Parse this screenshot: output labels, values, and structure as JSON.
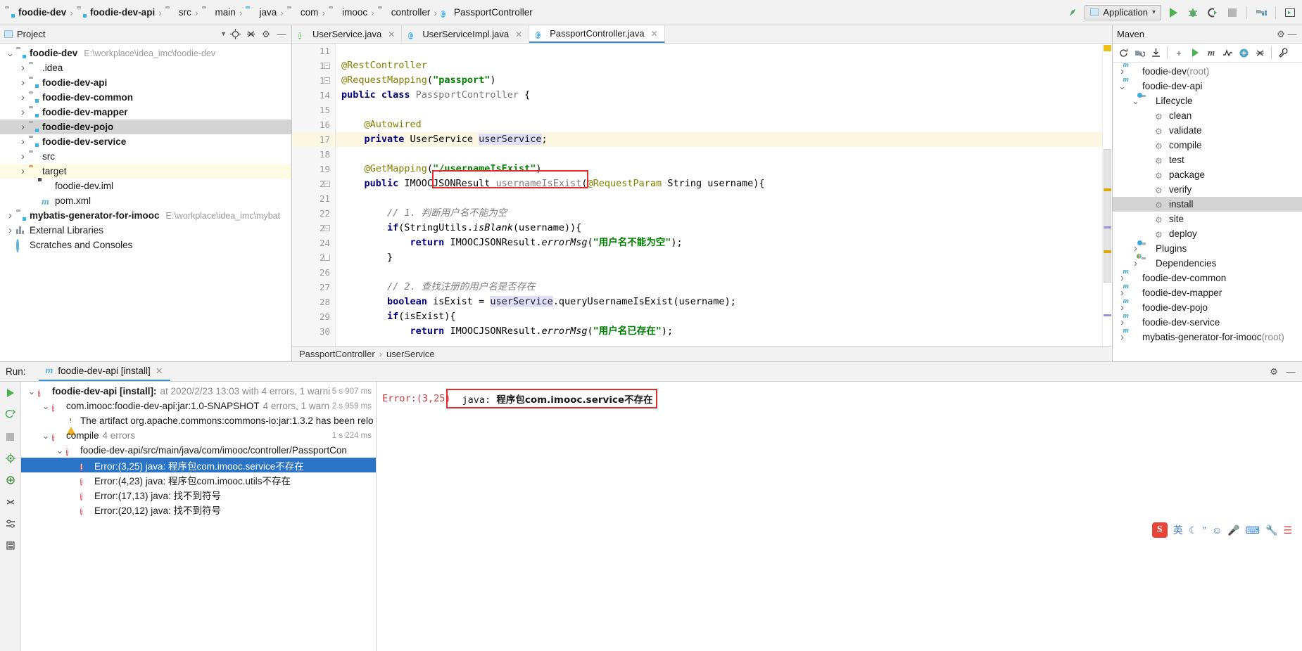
{
  "topbar": {
    "breadcrumbs": [
      {
        "label": "foodie-dev",
        "icon": "module-folder-icon",
        "bold": true
      },
      {
        "label": "foodie-dev-api",
        "icon": "module-folder-icon",
        "bold": true
      },
      {
        "label": "src",
        "icon": "folder-icon",
        "bold": false
      },
      {
        "label": "main",
        "icon": "folder-icon",
        "bold": false
      },
      {
        "label": "java",
        "icon": "source-folder-icon",
        "bold": false
      },
      {
        "label": "com",
        "icon": "package-folder-icon",
        "bold": false
      },
      {
        "label": "imooc",
        "icon": "package-folder-icon",
        "bold": false
      },
      {
        "label": "controller",
        "icon": "package-folder-icon",
        "bold": false
      },
      {
        "label": "PassportController",
        "icon": "class-icon",
        "bold": false
      }
    ],
    "run_config": "Application",
    "buttons": {
      "run": "run-button",
      "debug": "debug-button",
      "run_coverage": "run-with-coverage-button",
      "stop": "stop-button",
      "project_structure": "project-structure-button",
      "layout": "layout-button"
    }
  },
  "project": {
    "title": "Project",
    "tree": [
      {
        "label": "foodie-dev",
        "path": "E:\\workplace\\idea_imc\\foodie-dev",
        "indent": 0,
        "arrow": "down",
        "icon": "module-folder-icon",
        "bold": true,
        "state": "normal"
      },
      {
        "label": ".idea",
        "path": "",
        "indent": 1,
        "arrow": "right",
        "icon": "folder-icon",
        "bold": false,
        "state": "normal"
      },
      {
        "label": "foodie-dev-api",
        "path": "",
        "indent": 1,
        "arrow": "right",
        "icon": "module-folder-icon",
        "bold": true,
        "state": "normal"
      },
      {
        "label": "foodie-dev-common",
        "path": "",
        "indent": 1,
        "arrow": "right",
        "icon": "module-folder-icon",
        "bold": true,
        "state": "normal"
      },
      {
        "label": "foodie-dev-mapper",
        "path": "",
        "indent": 1,
        "arrow": "right",
        "icon": "module-folder-icon",
        "bold": true,
        "state": "normal"
      },
      {
        "label": "foodie-dev-pojo",
        "path": "",
        "indent": 1,
        "arrow": "right",
        "icon": "module-folder-icon",
        "bold": true,
        "state": "selected"
      },
      {
        "label": "foodie-dev-service",
        "path": "",
        "indent": 1,
        "arrow": "right",
        "icon": "module-folder-icon",
        "bold": true,
        "state": "normal"
      },
      {
        "label": "src",
        "path": "",
        "indent": 1,
        "arrow": "right",
        "icon": "folder-icon",
        "bold": false,
        "state": "normal"
      },
      {
        "label": "target",
        "path": "",
        "indent": 1,
        "arrow": "right",
        "icon": "target-folder-icon",
        "bold": false,
        "state": "highlight"
      },
      {
        "label": "foodie-dev.iml",
        "path": "",
        "indent": 2,
        "arrow": "",
        "icon": "iml-file-icon",
        "bold": false,
        "state": "normal"
      },
      {
        "label": "pom.xml",
        "path": "",
        "indent": 2,
        "arrow": "",
        "icon": "maven-file-icon",
        "bold": false,
        "state": "normal"
      },
      {
        "label": "mybatis-generator-for-imooc",
        "path": "E:\\workplace\\idea_imc\\mybat",
        "indent": 0,
        "arrow": "right",
        "icon": "module-folder-icon",
        "bold": true,
        "state": "normal"
      },
      {
        "label": "External Libraries",
        "path": "",
        "indent": 0,
        "arrow": "right",
        "icon": "library-icon",
        "bold": false,
        "state": "normal"
      },
      {
        "label": "Scratches and Consoles",
        "path": "",
        "indent": 0,
        "arrow": "",
        "icon": "scratches-icon",
        "bold": false,
        "state": "normal"
      }
    ]
  },
  "editor": {
    "tabs": [
      {
        "label": "UserService.java",
        "icon": "interface-icon",
        "active": false
      },
      {
        "label": "UserServiceImpl.java",
        "icon": "class-icon",
        "active": false
      },
      {
        "label": "PassportController.java",
        "icon": "class-icon",
        "active": true
      }
    ],
    "first_line": 11,
    "lines": [
      {
        "n": 11,
        "tokens": [],
        "highlight": false
      },
      {
        "n": 12,
        "tokens": [
          {
            "t": "@RestController",
            "c": "ann"
          }
        ],
        "highlight": false,
        "fold": "minus"
      },
      {
        "n": 13,
        "tokens": [
          {
            "t": "@RequestMapping",
            "c": "ann"
          },
          {
            "t": "(",
            "c": "plain"
          },
          {
            "t": "\"passport\"",
            "c": "str"
          },
          {
            "t": ")",
            "c": "plain"
          }
        ],
        "highlight": false,
        "fold": "minus"
      },
      {
        "n": 14,
        "tokens": [
          {
            "t": "public class ",
            "c": "kw"
          },
          {
            "t": "PassportController",
            "c": "cls"
          },
          {
            "t": " {",
            "c": "plain"
          }
        ],
        "highlight": false
      },
      {
        "n": 15,
        "tokens": [],
        "highlight": false
      },
      {
        "n": 16,
        "tokens": [
          {
            "t": "    @Autowired",
            "c": "ann"
          }
        ],
        "highlight": false
      },
      {
        "n": 17,
        "tokens": [
          {
            "t": "    private ",
            "c": "kw"
          },
          {
            "t": "UserService ",
            "c": "plain"
          },
          {
            "t": "userService",
            "c": "fld-hl"
          },
          {
            "t": ";",
            "c": "plain"
          }
        ],
        "highlight": true
      },
      {
        "n": 18,
        "tokens": [],
        "highlight": false
      },
      {
        "n": 19,
        "tokens": [
          {
            "t": "    @GetMapping",
            "c": "ann"
          },
          {
            "t": "(",
            "c": "plain"
          },
          {
            "t": "\"/usernameIsExist\"",
            "c": "str"
          },
          {
            "t": ")",
            "c": "plain"
          }
        ],
        "highlight": false
      },
      {
        "n": 20,
        "tokens": [
          {
            "t": "    public ",
            "c": "kw"
          },
          {
            "t": "IMOOCJSONResult ",
            "c": "plain"
          },
          {
            "t": "usernameIsExist",
            "c": "cls"
          },
          {
            "t": "(",
            "c": "plain"
          },
          {
            "t": "@RequestParam",
            "c": "ann"
          },
          {
            "t": " String username){",
            "c": "plain"
          }
        ],
        "highlight": false,
        "fold": "minus"
      },
      {
        "n": 21,
        "tokens": [],
        "highlight": false
      },
      {
        "n": 22,
        "tokens": [
          {
            "t": "        // 1. 判断用户名不能为空",
            "c": "cmt"
          }
        ],
        "highlight": false
      },
      {
        "n": 23,
        "tokens": [
          {
            "t": "        if",
            "c": "kw"
          },
          {
            "t": "(StringUtils.",
            "c": "plain"
          },
          {
            "t": "isBlank",
            "c": "mth"
          },
          {
            "t": "(username)){",
            "c": "plain"
          }
        ],
        "highlight": false,
        "fold": "minus"
      },
      {
        "n": 24,
        "tokens": [
          {
            "t": "            return ",
            "c": "kw"
          },
          {
            "t": "IMOOCJSONResult.",
            "c": "plain"
          },
          {
            "t": "errorMsg",
            "c": "mth"
          },
          {
            "t": "(",
            "c": "plain"
          },
          {
            "t": "\"用户名不能为空\"",
            "c": "str"
          },
          {
            "t": ");",
            "c": "plain"
          }
        ],
        "highlight": false
      },
      {
        "n": 25,
        "tokens": [
          {
            "t": "        }",
            "c": "plain"
          }
        ],
        "highlight": false,
        "fold": "end"
      },
      {
        "n": 26,
        "tokens": [],
        "highlight": false
      },
      {
        "n": 27,
        "tokens": [
          {
            "t": "        // 2. 查找注册的用户名是否存在",
            "c": "cmt"
          }
        ],
        "highlight": false
      },
      {
        "n": 28,
        "tokens": [
          {
            "t": "        boolean ",
            "c": "kw"
          },
          {
            "t": "isExist = ",
            "c": "plain"
          },
          {
            "t": "userService",
            "c": "fld-hl"
          },
          {
            "t": ".queryUsernameIsExist(username);",
            "c": "plain"
          }
        ],
        "highlight": false
      },
      {
        "n": 29,
        "tokens": [
          {
            "t": "        if",
            "c": "kw"
          },
          {
            "t": "(isExist){",
            "c": "plain"
          }
        ],
        "highlight": false
      },
      {
        "n": 30,
        "tokens": [
          {
            "t": "            return ",
            "c": "kw"
          },
          {
            "t": "IMOOCJSONResult.",
            "c": "plain"
          },
          {
            "t": "errorMsg",
            "c": "mth"
          },
          {
            "t": "(",
            "c": "plain"
          },
          {
            "t": "\"用户名已存在\"",
            "c": "str"
          },
          {
            "t": ");",
            "c": "plain"
          }
        ],
        "highlight": false
      }
    ],
    "breadcrumb": [
      "PassportController",
      "userService"
    ]
  },
  "maven": {
    "title": "Maven",
    "toolbar": [
      "reimport-icon",
      "generate-sources-icon",
      "download-sources-icon",
      "add-icon",
      "run-icon",
      "execute-goal-icon",
      "skip-tests-icon",
      "toggle-offline-icon",
      "collapse-all-icon",
      "settings-icon"
    ],
    "tree": [
      {
        "label": "foodie-dev",
        "suffix": " (root)",
        "indent": 0,
        "arrow": "right",
        "icon": "maven-project-icon",
        "state": "normal"
      },
      {
        "label": "foodie-dev-api",
        "suffix": "",
        "indent": 0,
        "arrow": "down",
        "icon": "maven-project-icon",
        "state": "normal"
      },
      {
        "label": "Lifecycle",
        "suffix": "",
        "indent": 1,
        "arrow": "down",
        "icon": "lifecycle-folder-icon",
        "state": "normal"
      },
      {
        "label": "clean",
        "suffix": "",
        "indent": 2,
        "arrow": "",
        "icon": "goal-icon",
        "state": "normal"
      },
      {
        "label": "validate",
        "suffix": "",
        "indent": 2,
        "arrow": "",
        "icon": "goal-icon",
        "state": "normal"
      },
      {
        "label": "compile",
        "suffix": "",
        "indent": 2,
        "arrow": "",
        "icon": "goal-icon",
        "state": "normal"
      },
      {
        "label": "test",
        "suffix": "",
        "indent": 2,
        "arrow": "",
        "icon": "goal-icon",
        "state": "normal"
      },
      {
        "label": "package",
        "suffix": "",
        "indent": 2,
        "arrow": "",
        "icon": "goal-icon",
        "state": "normal"
      },
      {
        "label": "verify",
        "suffix": "",
        "indent": 2,
        "arrow": "",
        "icon": "goal-icon",
        "state": "normal"
      },
      {
        "label": "install",
        "suffix": "",
        "indent": 2,
        "arrow": "",
        "icon": "goal-icon",
        "state": "selected"
      },
      {
        "label": "site",
        "suffix": "",
        "indent": 2,
        "arrow": "",
        "icon": "goal-icon",
        "state": "normal"
      },
      {
        "label": "deploy",
        "suffix": "",
        "indent": 2,
        "arrow": "",
        "icon": "goal-icon",
        "state": "normal"
      },
      {
        "label": "Plugins",
        "suffix": "",
        "indent": 1,
        "arrow": "right",
        "icon": "plugins-folder-icon",
        "state": "normal"
      },
      {
        "label": "Dependencies",
        "suffix": "",
        "indent": 1,
        "arrow": "right",
        "icon": "dependencies-folder-icon",
        "state": "normal"
      },
      {
        "label": "foodie-dev-common",
        "suffix": "",
        "indent": 0,
        "arrow": "right",
        "icon": "maven-project-icon",
        "state": "normal"
      },
      {
        "label": "foodie-dev-mapper",
        "suffix": "",
        "indent": 0,
        "arrow": "right",
        "icon": "maven-project-icon",
        "state": "normal"
      },
      {
        "label": "foodie-dev-pojo",
        "suffix": "",
        "indent": 0,
        "arrow": "right",
        "icon": "maven-project-icon",
        "state": "normal"
      },
      {
        "label": "foodie-dev-service",
        "suffix": "",
        "indent": 0,
        "arrow": "right",
        "icon": "maven-project-icon",
        "state": "normal"
      },
      {
        "label": "mybatis-generator-for-imooc",
        "suffix": " (root)",
        "indent": 0,
        "arrow": "right",
        "icon": "maven-project-icon",
        "state": "normal"
      }
    ]
  },
  "run": {
    "label": "Run:",
    "tab": "foodie-dev-api [install]",
    "rail": [
      "rerun-icon",
      "rerun-failed-icon",
      "stop-icon",
      "toggle-tasks-icon",
      "expand-icon",
      "collapse-icon",
      "settings-icon",
      "pin-icon"
    ],
    "tree": [
      {
        "indent": 0,
        "arrow": "down",
        "icon": "error-icon",
        "bold_label": "foodie-dev-api [install]:",
        "meta": "at 2020/2/23 13:03 with 4 errors, 1 warni",
        "time": "5 s 907 ms",
        "selected": false
      },
      {
        "indent": 1,
        "arrow": "down",
        "icon": "error-icon",
        "bold_label": "",
        "label": "com.imooc:foodie-dev-api:jar:1.0-SNAPSHOT",
        "meta": "4 errors, 1 warn",
        "time": "2 s 959 ms",
        "selected": false
      },
      {
        "indent": 2,
        "arrow": "",
        "icon": "warning-icon",
        "label": "The artifact org.apache.commons:commons-io:jar:1.3.2 has been relo",
        "meta": "",
        "time": "",
        "selected": false
      },
      {
        "indent": 1,
        "arrow": "down",
        "icon": "error-icon",
        "label": "compile",
        "meta": "4 errors",
        "time": "1 s 224 ms",
        "selected": false
      },
      {
        "indent": 2,
        "arrow": "down",
        "icon": "error-icon",
        "label": "foodie-dev-api/src/main/java/com/imooc/controller/PassportCon",
        "meta": "",
        "time": "",
        "selected": false
      },
      {
        "indent": 3,
        "arrow": "",
        "icon": "error-icon",
        "label": "Error:(3,25) java: 程序包com.imooc.service不存在",
        "meta": "",
        "time": "",
        "selected": true
      },
      {
        "indent": 3,
        "arrow": "",
        "icon": "error-icon",
        "label": "Error:(4,23) java: 程序包com.imooc.utils不存在",
        "meta": "",
        "time": "",
        "selected": false
      },
      {
        "indent": 3,
        "arrow": "",
        "icon": "error-icon",
        "label": "Error:(17,13) java: 找不到符号",
        "meta": "",
        "time": "",
        "selected": false
      },
      {
        "indent": 3,
        "arrow": "",
        "icon": "error-icon",
        "label": "Error:(20,12) java: 找不到符号",
        "meta": "",
        "time": "",
        "selected": false
      }
    ],
    "detail": {
      "location": "Error:(3,25)",
      "message_prefix": "java: ",
      "message_body": "程序包com.imooc.service不存在"
    }
  },
  "ime": {
    "logo": "S",
    "items": [
      "英",
      "moon-icon",
      "quote-icon",
      "smiley-icon",
      "mic-icon",
      "keyboard-icon",
      "toolbox-icon",
      "menu-icon"
    ]
  },
  "colors": {
    "accent_blue": "#3d90d0",
    "error_red": "#e32b2b",
    "selection_blue": "#2a74c8",
    "warning_yellow": "#f0b323",
    "highlight_yellow": "#fcf7e3"
  }
}
